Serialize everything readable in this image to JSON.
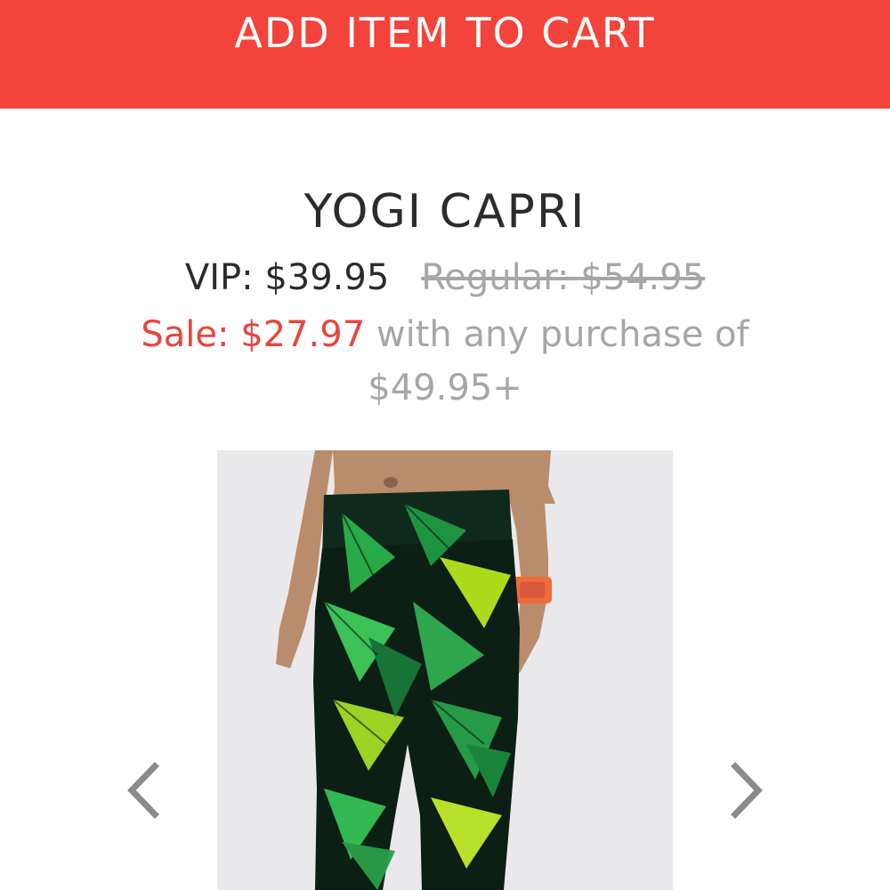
{
  "cart": {
    "button_label": "ADD ITEM TO CART",
    "color": "#f4433a"
  },
  "product": {
    "title": "YOGI CAPRI",
    "vip_price": "VIP: $39.95",
    "regular_price": "Regular: $54.95",
    "sale_price": "Sale: $27.97",
    "sale_condition": "with any purchase of $49.95+"
  },
  "gallery": {
    "prev_icon": "chevron-left-icon",
    "next_icon": "chevron-right-icon",
    "image_subject": "model wearing tropical palm print capri pants"
  },
  "colors": {
    "sale": "#e8453c",
    "muted": "#a6a6a6",
    "text": "#2b2b2b"
  }
}
